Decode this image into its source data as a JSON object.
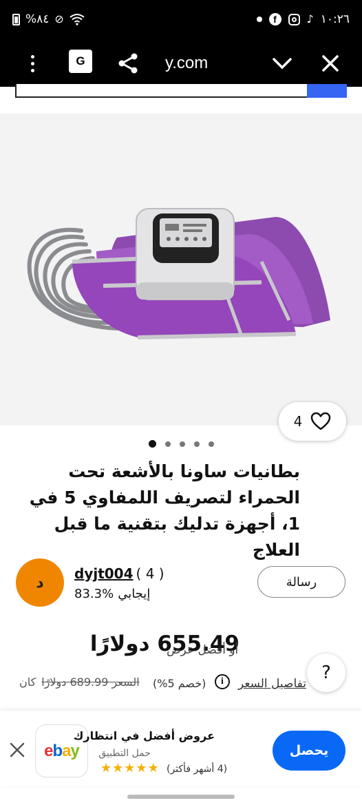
{
  "status_bar": {
    "battery_text": "%٨٤",
    "time": "١٠:٢٦"
  },
  "browser": {
    "url": "y.com",
    "translate_icon_text": "G"
  },
  "product": {
    "title": "بطانيات ساونا بالأشعة تحت الحمراء لتصريف اللمفاوي 5 في 1، أجهزة تدليك بتقنية ما قبل العلاج",
    "watch_count": "4",
    "image_count": 5,
    "active_image": 0
  },
  "seller": {
    "avatar_letter": "د",
    "name": "dyjt004",
    "feedback_count": "( 4 )",
    "feedback_percent": "83.3%",
    "feedback_label": "إيجابي",
    "message_label": "رسالة"
  },
  "price": {
    "current": "655.49 دولارًا",
    "best_offer": "أو أفضل عرض",
    "details_link": "تفاصيل السعر",
    "discount": "(خصم 5%)",
    "was_label": "كان",
    "original": "السعر 689.99 دولارًا",
    "help_label": "?"
  },
  "app_banner": {
    "title": "عروض أفضل في انتظارك",
    "subtitle": "حمل التطبيق",
    "rating_text": "(4 أشهر فأكثر)",
    "stars": 5,
    "get_label": "يحصل",
    "logo": {
      "e": "e",
      "b": "b",
      "a": "a",
      "y": "y"
    }
  },
  "colors": {
    "accent_blue": "#0968f6",
    "avatar_orange": "#f08600",
    "ebay_red": "#e53238",
    "ebay_blue": "#0064d2",
    "ebay_yellow": "#f5af02",
    "ebay_green": "#86b817"
  }
}
